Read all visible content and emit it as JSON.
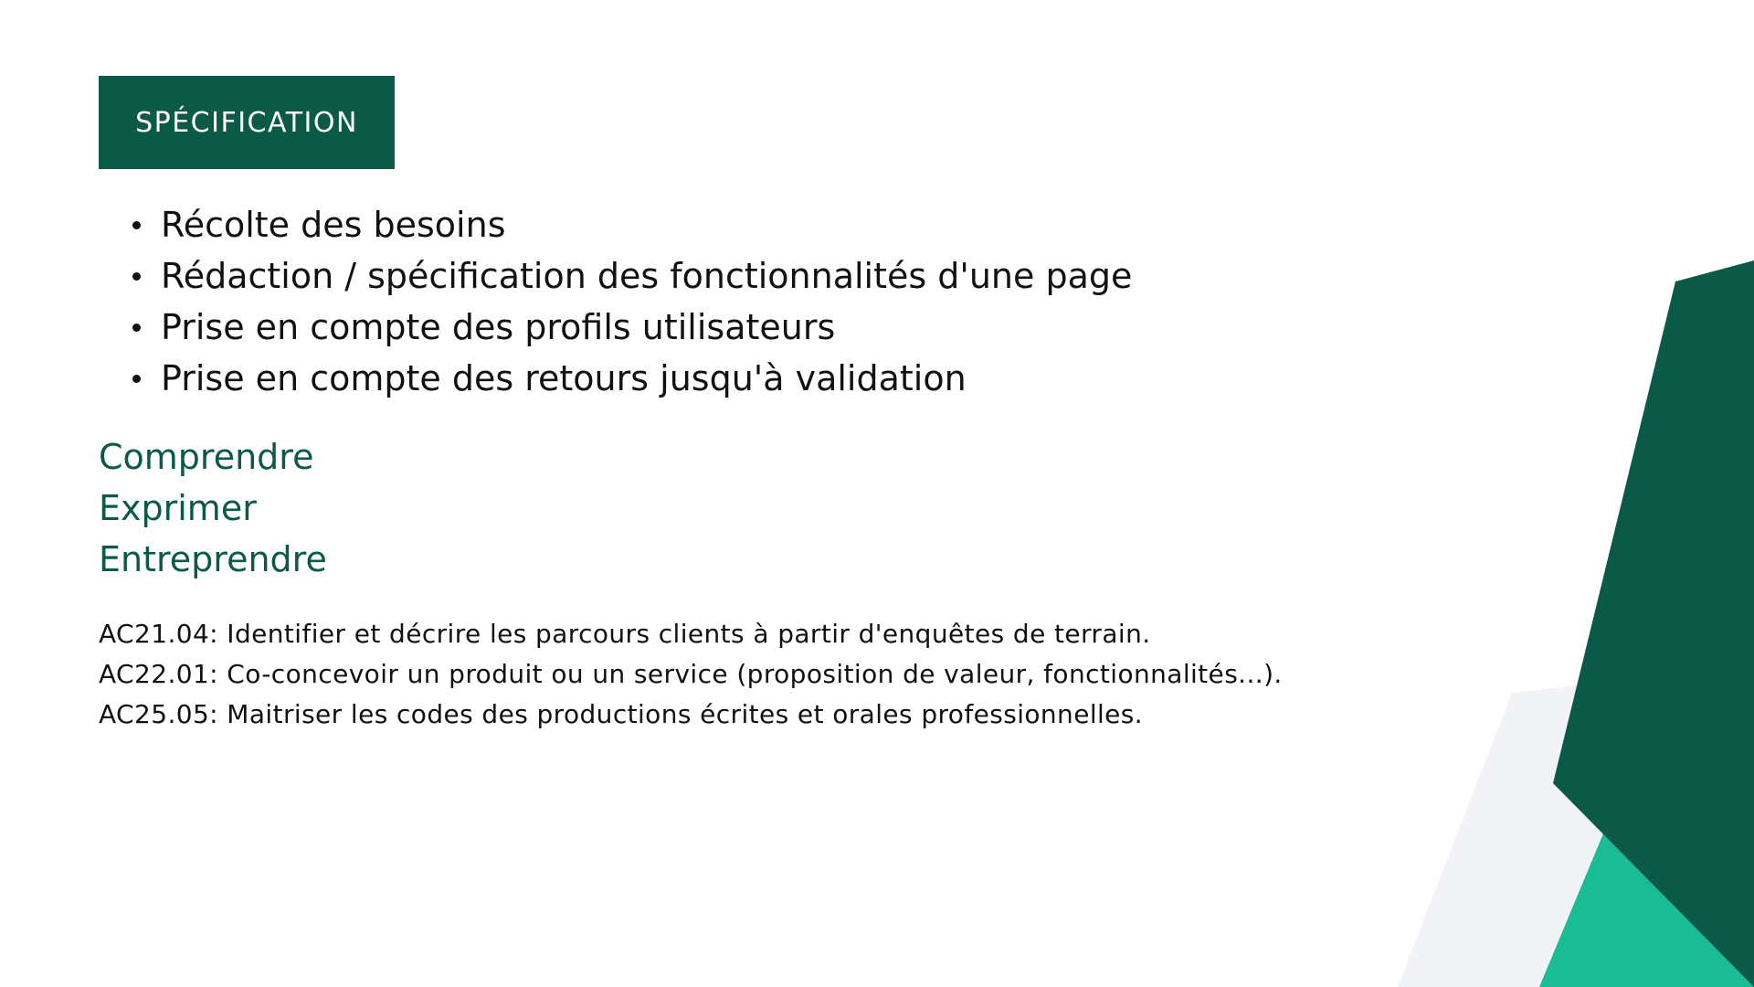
{
  "colors": {
    "primary": "#0b5a48",
    "accent": "#1abc96",
    "light": "#f2f3f7",
    "text": "#111111"
  },
  "header": {
    "badge_label": "SPÉCIFICATION"
  },
  "tasks": [
    "Récolte des besoins",
    "Rédaction / spécification des fonctionnalités d'une page",
    "Prise en compte des profils utilisateurs",
    "Prise en compte des retours jusqu'à validation"
  ],
  "competencies": [
    "Comprendre",
    "Exprimer",
    "Entreprendre"
  ],
  "criteria": [
    "AC21.04: Identifier et décrire les parcours clients à partir d'enquêtes de terrain.",
    "AC22.01: Co-concevoir un produit ou un service (proposition de valeur, fonctionnalités...).",
    "AC25.05: Maitriser les codes des productions écrites et orales professionnelles."
  ]
}
